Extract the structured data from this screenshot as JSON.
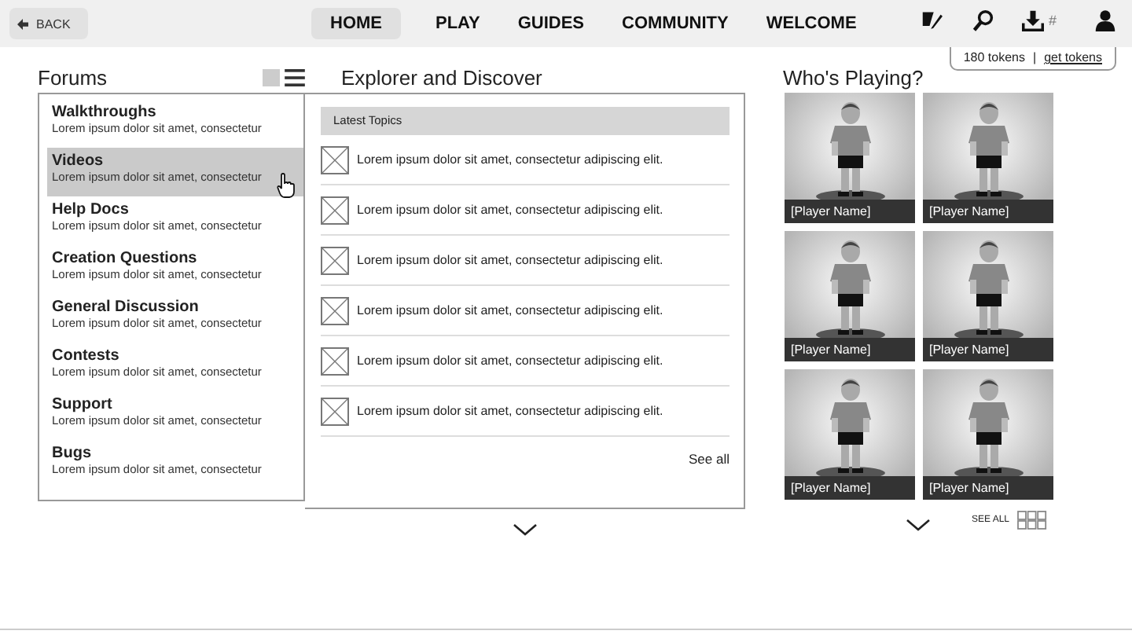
{
  "header": {
    "back": "BACK",
    "nav": [
      {
        "label": "HOME",
        "selected": true
      },
      {
        "label": "PLAY",
        "selected": false
      },
      {
        "label": "GUIDES",
        "selected": false
      },
      {
        "label": "COMMUNITY",
        "selected": false
      },
      {
        "label": "WELCOME",
        "selected": false
      }
    ],
    "download_mark": "#"
  },
  "tokens": {
    "count": "180 tokens",
    "separator": "|",
    "link": "get tokens"
  },
  "forums": {
    "title": "Forums",
    "items": [
      {
        "title": "Walkthroughs",
        "desc": "Lorem ipsum dolor sit amet, consectetur",
        "selected": false
      },
      {
        "title": "Videos",
        "desc": "Lorem ipsum dolor sit amet, consectetur",
        "selected": true
      },
      {
        "title": "Help Docs",
        "desc": "Lorem ipsum dolor sit amet, consectetur",
        "selected": false
      },
      {
        "title": "Creation Questions",
        "desc": "Lorem ipsum dolor sit amet, consectetur",
        "selected": false
      },
      {
        "title": "General Discussion",
        "desc": "Lorem ipsum dolor sit amet, consectetur",
        "selected": false
      },
      {
        "title": "Contests",
        "desc": "Lorem ipsum dolor sit amet, consectetur",
        "selected": false
      },
      {
        "title": "Support",
        "desc": "Lorem ipsum dolor sit amet, consectetur",
        "selected": false
      },
      {
        "title": "Bugs",
        "desc": "Lorem ipsum dolor sit amet, consectetur",
        "selected": false
      }
    ]
  },
  "explorer": {
    "title": "Explorer and Discover",
    "header": "Latest Topics",
    "topics": [
      "Lorem ipsum dolor sit amet, consectetur adipiscing elit.",
      "Lorem ipsum dolor sit amet, consectetur adipiscing elit.",
      "Lorem ipsum dolor sit amet, consectetur adipiscing elit.",
      "Lorem ipsum dolor sit amet, consectetur adipiscing elit.",
      "Lorem ipsum dolor sit amet, consectetur adipiscing elit.",
      "Lorem ipsum dolor sit amet, consectetur adipiscing elit."
    ],
    "see_all": "See all"
  },
  "players": {
    "title": "Who's Playing?",
    "items": [
      {
        "name": "[Player Name]",
        "kind": "picture"
      },
      {
        "name": "[Player Name]",
        "kind": "picture"
      },
      {
        "name": "[Player Name]",
        "kind": "picture"
      },
      {
        "name": "[Player Name]",
        "kind": "picture"
      },
      {
        "name": "[Player Name]",
        "kind": "picture"
      },
      {
        "name": "[Player Name]",
        "kind": "picture"
      }
    ],
    "see_all": "SEE ALL"
  }
}
